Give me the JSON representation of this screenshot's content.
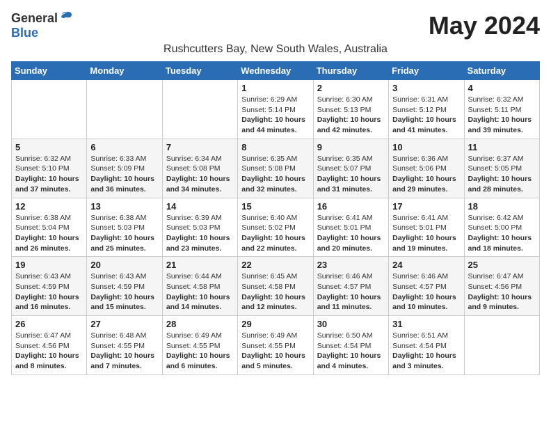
{
  "header": {
    "logo": {
      "general": "General",
      "blue": "Blue"
    },
    "month_year": "May 2024",
    "location": "Rushcutters Bay, New South Wales, Australia"
  },
  "days_of_week": [
    "Sunday",
    "Monday",
    "Tuesday",
    "Wednesday",
    "Thursday",
    "Friday",
    "Saturday"
  ],
  "weeks": [
    {
      "cells": [
        {
          "day": "",
          "content": ""
        },
        {
          "day": "",
          "content": ""
        },
        {
          "day": "",
          "content": ""
        },
        {
          "day": "1",
          "content": "Sunrise: 6:29 AM\nSunset: 5:14 PM\nDaylight: 10 hours and 44 minutes."
        },
        {
          "day": "2",
          "content": "Sunrise: 6:30 AM\nSunset: 5:13 PM\nDaylight: 10 hours and 42 minutes."
        },
        {
          "day": "3",
          "content": "Sunrise: 6:31 AM\nSunset: 5:12 PM\nDaylight: 10 hours and 41 minutes."
        },
        {
          "day": "4",
          "content": "Sunrise: 6:32 AM\nSunset: 5:11 PM\nDaylight: 10 hours and 39 minutes."
        }
      ]
    },
    {
      "cells": [
        {
          "day": "5",
          "content": "Sunrise: 6:32 AM\nSunset: 5:10 PM\nDaylight: 10 hours and 37 minutes."
        },
        {
          "day": "6",
          "content": "Sunrise: 6:33 AM\nSunset: 5:09 PM\nDaylight: 10 hours and 36 minutes."
        },
        {
          "day": "7",
          "content": "Sunrise: 6:34 AM\nSunset: 5:08 PM\nDaylight: 10 hours and 34 minutes."
        },
        {
          "day": "8",
          "content": "Sunrise: 6:35 AM\nSunset: 5:08 PM\nDaylight: 10 hours and 32 minutes."
        },
        {
          "day": "9",
          "content": "Sunrise: 6:35 AM\nSunset: 5:07 PM\nDaylight: 10 hours and 31 minutes."
        },
        {
          "day": "10",
          "content": "Sunrise: 6:36 AM\nSunset: 5:06 PM\nDaylight: 10 hours and 29 minutes."
        },
        {
          "day": "11",
          "content": "Sunrise: 6:37 AM\nSunset: 5:05 PM\nDaylight: 10 hours and 28 minutes."
        }
      ]
    },
    {
      "cells": [
        {
          "day": "12",
          "content": "Sunrise: 6:38 AM\nSunset: 5:04 PM\nDaylight: 10 hours and 26 minutes."
        },
        {
          "day": "13",
          "content": "Sunrise: 6:38 AM\nSunset: 5:03 PM\nDaylight: 10 hours and 25 minutes."
        },
        {
          "day": "14",
          "content": "Sunrise: 6:39 AM\nSunset: 5:03 PM\nDaylight: 10 hours and 23 minutes."
        },
        {
          "day": "15",
          "content": "Sunrise: 6:40 AM\nSunset: 5:02 PM\nDaylight: 10 hours and 22 minutes."
        },
        {
          "day": "16",
          "content": "Sunrise: 6:41 AM\nSunset: 5:01 PM\nDaylight: 10 hours and 20 minutes."
        },
        {
          "day": "17",
          "content": "Sunrise: 6:41 AM\nSunset: 5:01 PM\nDaylight: 10 hours and 19 minutes."
        },
        {
          "day": "18",
          "content": "Sunrise: 6:42 AM\nSunset: 5:00 PM\nDaylight: 10 hours and 18 minutes."
        }
      ]
    },
    {
      "cells": [
        {
          "day": "19",
          "content": "Sunrise: 6:43 AM\nSunset: 4:59 PM\nDaylight: 10 hours and 16 minutes."
        },
        {
          "day": "20",
          "content": "Sunrise: 6:43 AM\nSunset: 4:59 PM\nDaylight: 10 hours and 15 minutes."
        },
        {
          "day": "21",
          "content": "Sunrise: 6:44 AM\nSunset: 4:58 PM\nDaylight: 10 hours and 14 minutes."
        },
        {
          "day": "22",
          "content": "Sunrise: 6:45 AM\nSunset: 4:58 PM\nDaylight: 10 hours and 12 minutes."
        },
        {
          "day": "23",
          "content": "Sunrise: 6:46 AM\nSunset: 4:57 PM\nDaylight: 10 hours and 11 minutes."
        },
        {
          "day": "24",
          "content": "Sunrise: 6:46 AM\nSunset: 4:57 PM\nDaylight: 10 hours and 10 minutes."
        },
        {
          "day": "25",
          "content": "Sunrise: 6:47 AM\nSunset: 4:56 PM\nDaylight: 10 hours and 9 minutes."
        }
      ]
    },
    {
      "cells": [
        {
          "day": "26",
          "content": "Sunrise: 6:47 AM\nSunset: 4:56 PM\nDaylight: 10 hours and 8 minutes."
        },
        {
          "day": "27",
          "content": "Sunrise: 6:48 AM\nSunset: 4:55 PM\nDaylight: 10 hours and 7 minutes."
        },
        {
          "day": "28",
          "content": "Sunrise: 6:49 AM\nSunset: 4:55 PM\nDaylight: 10 hours and 6 minutes."
        },
        {
          "day": "29",
          "content": "Sunrise: 6:49 AM\nSunset: 4:55 PM\nDaylight: 10 hours and 5 minutes."
        },
        {
          "day": "30",
          "content": "Sunrise: 6:50 AM\nSunset: 4:54 PM\nDaylight: 10 hours and 4 minutes."
        },
        {
          "day": "31",
          "content": "Sunrise: 6:51 AM\nSunset: 4:54 PM\nDaylight: 10 hours and 3 minutes."
        },
        {
          "day": "",
          "content": ""
        }
      ]
    }
  ]
}
